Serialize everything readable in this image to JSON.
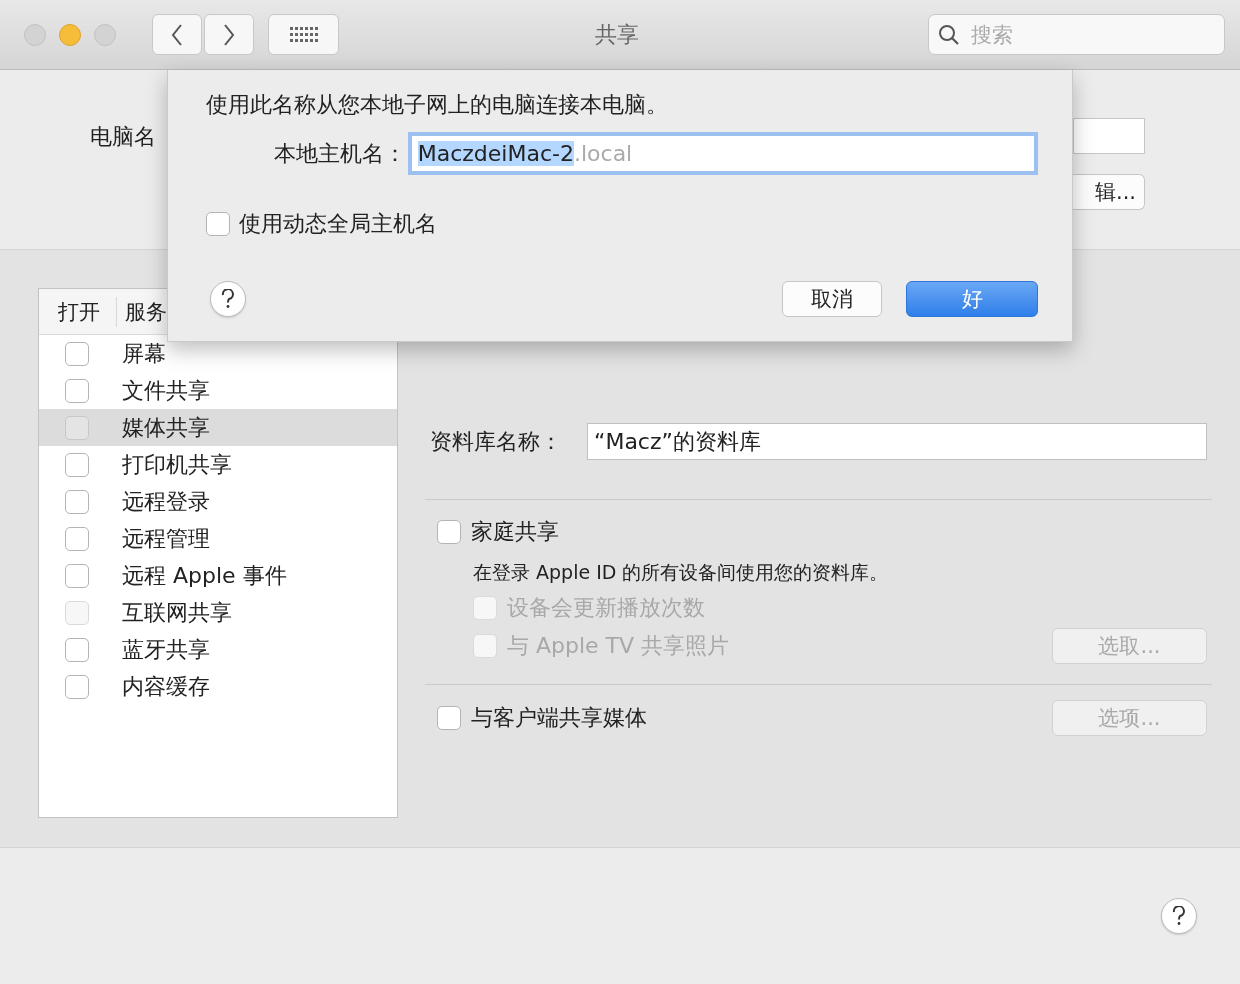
{
  "window": {
    "title": "共享"
  },
  "search": {
    "placeholder": "搜索"
  },
  "computer_name": {
    "label": "电脑名",
    "edit_button": "辑..."
  },
  "services": {
    "columns": [
      "打开",
      "服务"
    ],
    "items": [
      {
        "name": "屏幕",
        "checked": false,
        "disabled": false,
        "selected": false
      },
      {
        "name": "文件共享",
        "checked": false,
        "disabled": false,
        "selected": false
      },
      {
        "name": "媒体共享",
        "checked": false,
        "disabled": false,
        "selected": true
      },
      {
        "name": "打印机共享",
        "checked": false,
        "disabled": false,
        "selected": false
      },
      {
        "name": "远程登录",
        "checked": false,
        "disabled": false,
        "selected": false
      },
      {
        "name": "远程管理",
        "checked": false,
        "disabled": false,
        "selected": false
      },
      {
        "name": "远程 Apple 事件",
        "checked": false,
        "disabled": false,
        "selected": false
      },
      {
        "name": "互联网共享",
        "checked": false,
        "disabled": true,
        "selected": false
      },
      {
        "name": "蓝牙共享",
        "checked": false,
        "disabled": false,
        "selected": false
      },
      {
        "name": "内容缓存",
        "checked": false,
        "disabled": false,
        "selected": false
      }
    ]
  },
  "media_sharing": {
    "library_label": "资料库名称：",
    "library_name": "“Macz”的资料库",
    "home_sharing": {
      "label": "家庭共享",
      "checked": false
    },
    "description": "在登录 Apple ID 的所有设备间使用您的资料库。",
    "options": [
      {
        "label": "设备会更新播放次数",
        "checked": false,
        "disabled": true
      },
      {
        "label": "与 Apple TV 共享照片",
        "checked": false,
        "disabled": true
      }
    ],
    "choose_button": {
      "label": "选取...",
      "disabled": true
    },
    "share_with_clients": {
      "label": "与客户端共享媒体",
      "checked": false
    },
    "options_button": {
      "label": "选项...",
      "disabled": true
    }
  },
  "sheet": {
    "message": "使用此名称从您本地子网上的电脑连接本电脑。",
    "hostname_label": "本地主机名：",
    "hostname": {
      "value": "MaczdeiMac-2",
      "suffix": ".local",
      "selected": true
    },
    "dynamic_hostname": {
      "label": "使用动态全局主机名",
      "checked": false
    },
    "cancel": "取消",
    "ok": "好"
  }
}
